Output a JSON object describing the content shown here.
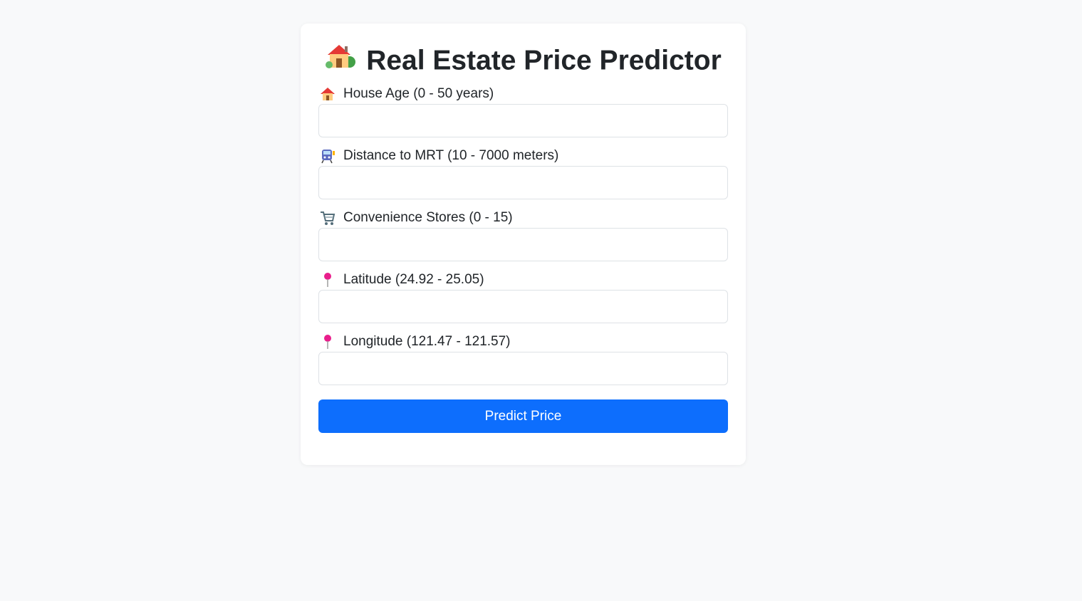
{
  "header": {
    "title": "Real Estate Price Predictor",
    "icon": "house-with-garden-icon"
  },
  "form": {
    "fields": [
      {
        "label": "House Age (0 - 50 years)",
        "icon": "house-icon",
        "value": "",
        "placeholder": ""
      },
      {
        "label": "Distance to MRT (10 - 7000 meters)",
        "icon": "train-icon",
        "value": "",
        "placeholder": ""
      },
      {
        "label": "Convenience Stores (0 - 15)",
        "icon": "shopping-cart-icon",
        "value": "",
        "placeholder": ""
      },
      {
        "label": "Latitude (24.92 - 25.05)",
        "icon": "pin-icon",
        "value": "",
        "placeholder": ""
      },
      {
        "label": "Longitude (121.47 - 121.57)",
        "icon": "pin-icon",
        "value": "",
        "placeholder": ""
      }
    ],
    "submit_label": "Predict Price"
  },
  "colors": {
    "accent": "#0d6efd",
    "background": "#f8f9fa",
    "card": "#ffffff"
  }
}
